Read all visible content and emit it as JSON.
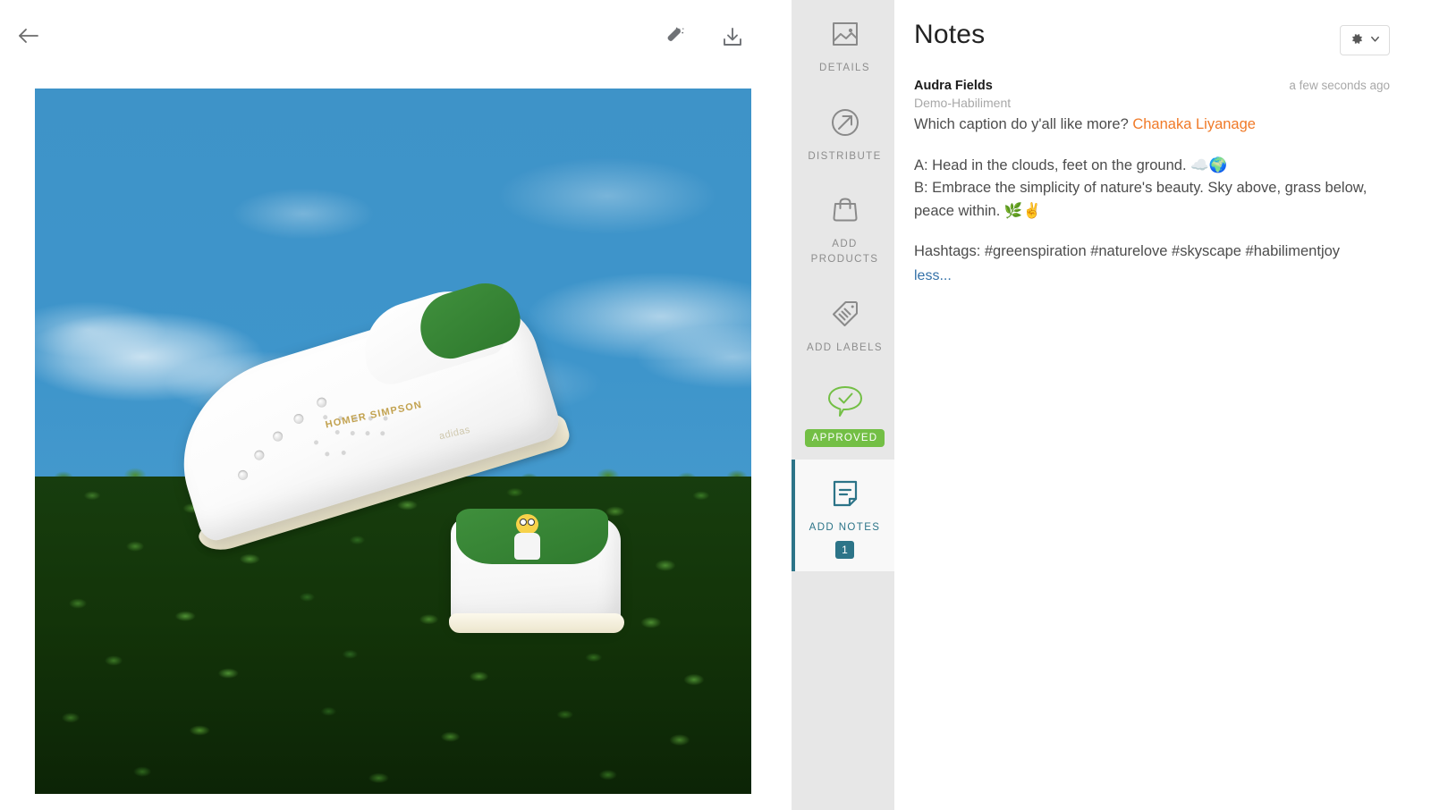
{
  "toolbar": {
    "back_label": "Back",
    "back_icon": "arrow-left-icon",
    "magic_wand_label": "Enhance",
    "magic_wand_icon": "magic-wand-icon",
    "download_label": "Download",
    "download_icon": "download-icon"
  },
  "preview": {
    "alt": "White Stan Smith sneakers with green heel patches resting on a green hedge against a blue sky",
    "sky_color": "#3f96ca",
    "hedge_color": "#133409",
    "shoe_text": "HOMER SIMPSON",
    "shoe_brand": "adidas"
  },
  "sidebar": {
    "items": [
      {
        "id": "details",
        "label": "DETAILS",
        "icon": "image-icon",
        "active": false
      },
      {
        "id": "distribute",
        "label": "DISTRIBUTE",
        "icon": "share-arrow-circle-icon",
        "active": false
      },
      {
        "id": "add-products",
        "label": "ADD PRODUCTS",
        "icon": "shopping-bag-icon",
        "active": false
      },
      {
        "id": "add-labels",
        "label": "ADD LABELS",
        "icon": "tag-icon",
        "active": false
      },
      {
        "id": "approval",
        "label": "",
        "icon": "approved-check-bubble-icon",
        "badge": "APPROVED",
        "badge_color": "#73bf45",
        "active": false
      },
      {
        "id": "add-notes",
        "label": "ADD NOTES",
        "icon": "note-icon",
        "count": "1",
        "active": true
      }
    ],
    "active_color": "#2c7488",
    "background": "#e7e7e7"
  },
  "notes": {
    "title": "Notes",
    "settings_icon": "gear-icon",
    "settings_chevron_icon": "chevron-down-icon",
    "entry": {
      "author": "Audra Fields",
      "timestamp": "a few seconds ago",
      "subtitle": "Demo-Habiliment",
      "line1_prefix": "Which caption do y'all like more? ",
      "mention": "Chanaka Liyanage",
      "option_a": "A: Head in the clouds, feet on the ground. ☁️🌍",
      "option_b": "B: Embrace the simplicity of nature's beauty. Sky above, grass below, peace within. 🌿✌️",
      "hashtags": "Hashtags: #greenspiration #naturelove #skyscape #habilimentjoy",
      "less_label": "less...",
      "mention_color": "#f07a28",
      "less_color": "#3471a8"
    }
  }
}
